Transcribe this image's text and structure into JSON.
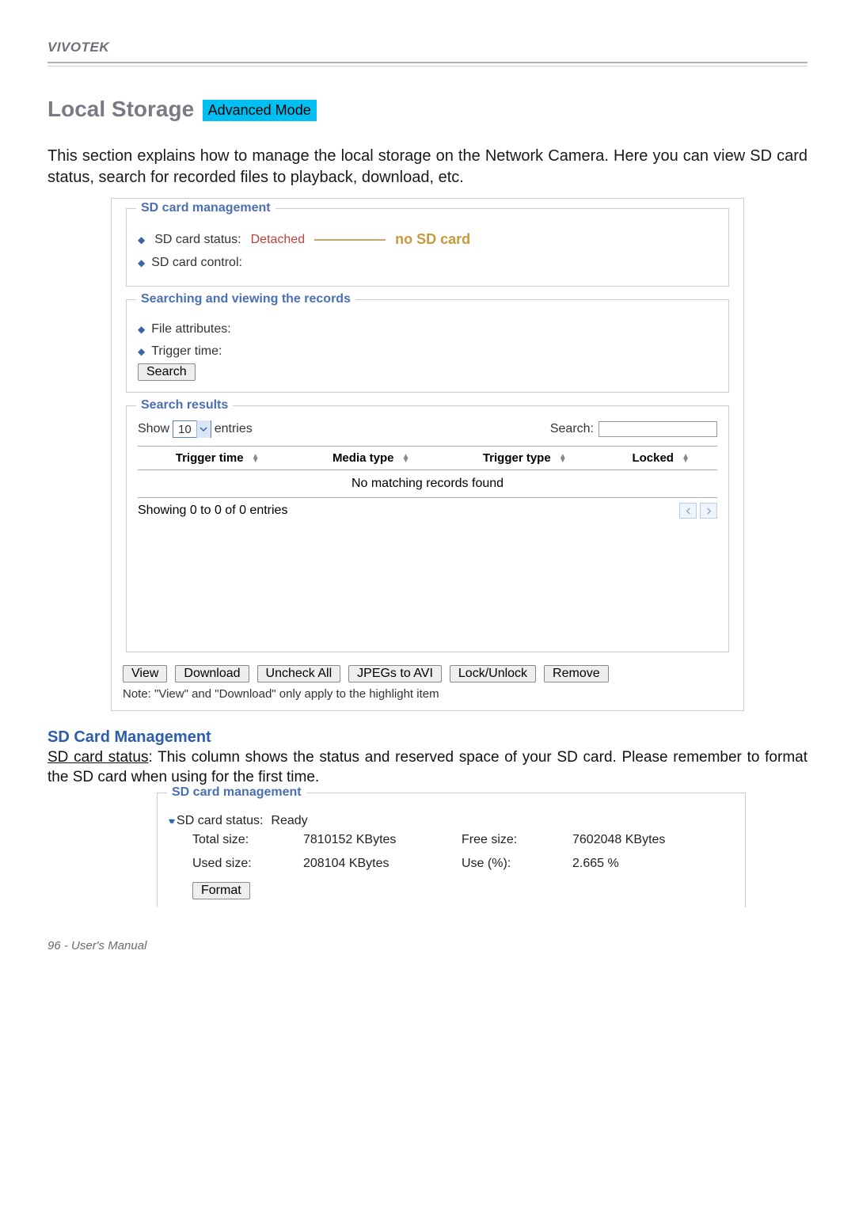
{
  "header": {
    "brand": "VIVOTEK"
  },
  "title": {
    "heading": "Local Storage",
    "badge": "Advanced Mode"
  },
  "intro": "This section explains how to manage the local storage on the Network Camera. Here you can view SD card status, search for recorded files to playback, download, etc.",
  "fig1": {
    "sd_mgmt_legend": "SD card management",
    "sd_status_label": "SD card status:",
    "sd_status_value": "Detached",
    "sd_status_annot": "no SD card",
    "sd_control_label": "SD card control:",
    "search_legend": "Searching and viewing the records",
    "file_attr_label": "File attributes:",
    "trigger_time_label": "Trigger time:",
    "search_button": "Search",
    "results_legend": "Search results",
    "show_label": "Show",
    "show_value": "10",
    "entries_label": "entries",
    "filter_label": "Search:",
    "columns": [
      "Trigger time",
      "Media type",
      "Trigger type",
      "Locked"
    ],
    "no_match": "No matching records found",
    "showing_info": "Showing 0 to 0 of 0 entries",
    "actions": [
      "View",
      "Download",
      "Uncheck All",
      "JPEGs to AVI",
      "Lock/Unlock",
      "Remove"
    ],
    "note": "Note: \"View\" and \"Download\" only apply to the highlight item"
  },
  "section2": {
    "heading": "SD Card Management",
    "p_lead_underline": "SD card status",
    "p_rest": ": This column shows the status and reserved space of your SD card. Please remember to format the SD card when using for the first time."
  },
  "fig2": {
    "legend": "SD card management",
    "status_label": "SD card status:",
    "status_value": "Ready",
    "stats": {
      "total_label": "Total size:",
      "total_value": "7810152 KBytes",
      "free_label": "Free size:",
      "free_value": "7602048 KBytes",
      "used_label": "Used size:",
      "used_value": "208104 KBytes",
      "pct_label": "Use (%):",
      "pct_value": "2.665 %"
    },
    "format_button": "Format"
  },
  "footer": {
    "page": "96 - User's Manual"
  }
}
